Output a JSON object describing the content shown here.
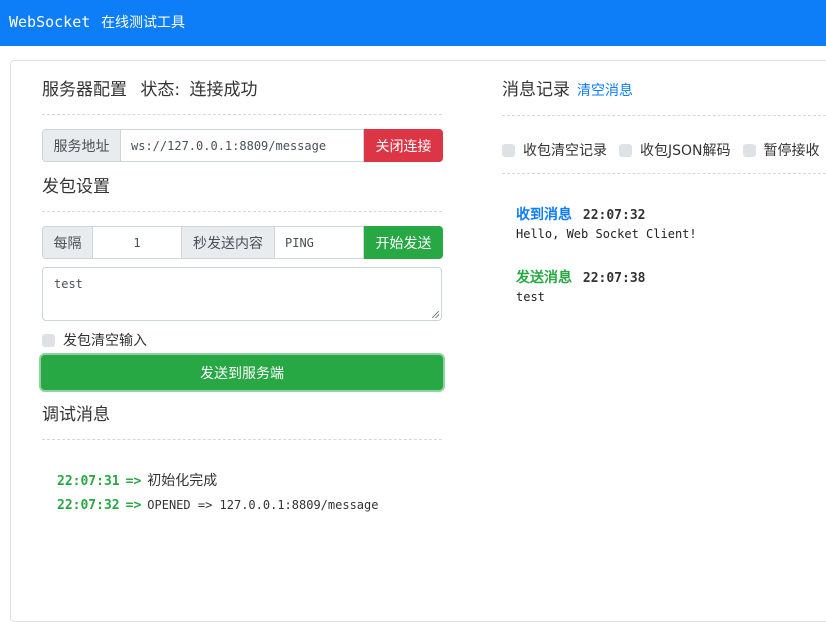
{
  "navbar": {
    "brand_main": "WebSocket",
    "brand_sub": "在线测试工具"
  },
  "config": {
    "title": "服务器配置",
    "status_label": "状态:",
    "status_value": "连接成功",
    "server_addon": "服务地址",
    "server_url": "ws://127.0.0.1:8809/message",
    "close_button": "关闭连接"
  },
  "send_settings": {
    "title": "发包设置",
    "every_label": "每隔",
    "interval_value": "1",
    "content_label": "秒发送内容",
    "content_value": "PING",
    "start_button": "开始发送",
    "textarea_value": "test",
    "clear_input_label": "发包清空输入",
    "send_button": "发送到服务端"
  },
  "debug": {
    "title": "调试消息",
    "arrow": "=>",
    "entries": [
      {
        "time": "22:07:31",
        "text": "初始化完成"
      },
      {
        "time": "22:07:32",
        "text": "OPENED => 127.0.0.1:8809/message"
      }
    ]
  },
  "messages": {
    "title": "消息记录",
    "clear_link": "清空消息",
    "options": [
      "收包清空记录",
      "收包JSON解码",
      "暂停接收"
    ],
    "items": [
      {
        "type": "收到消息",
        "time": "22:07:32",
        "body": "Hello, Web Socket Client!",
        "color": "#0d7ef7"
      },
      {
        "type": "发送消息",
        "time": "22:07:38",
        "body": "test",
        "color": "#28a745"
      }
    ]
  },
  "colors": {
    "primary": "#0d7ef7",
    "success": "#28a745",
    "danger": "#dc3545"
  }
}
